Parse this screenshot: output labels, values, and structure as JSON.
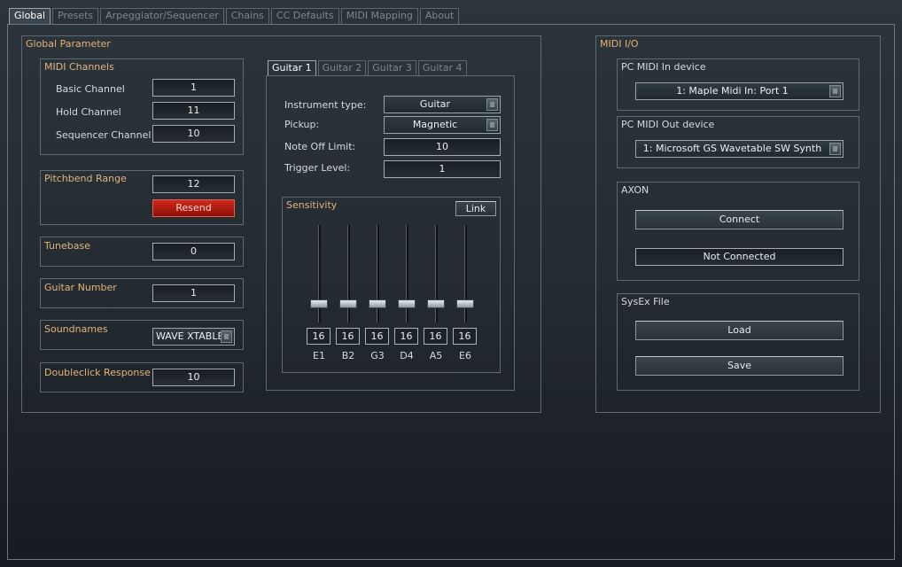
{
  "tabs": [
    "Global",
    "Presets",
    "Arpeggiator/Sequencer",
    "Chains",
    "CC Defaults",
    "MIDI Mapping",
    "About"
  ],
  "active_tab": "Global",
  "global_parameter": {
    "title": "Global Parameter",
    "midi_channels": {
      "title": "MIDI Channels",
      "basic_label": "Basic Channel",
      "basic_value": "1",
      "hold_label": "Hold Channel",
      "hold_value": "11",
      "sequencer_label": "Sequencer Channel",
      "sequencer_value": "10"
    },
    "pitchbend": {
      "title": "Pitchbend Range",
      "value": "12",
      "resend": "Resend"
    },
    "tunebase": {
      "title": "Tunebase",
      "value": "0"
    },
    "guitar_number": {
      "title": "Guitar Number",
      "value": "1"
    },
    "soundnames": {
      "title": "Soundnames",
      "value": "WAVE XTABLE"
    },
    "doubleclick": {
      "title": "Doubleclick Response",
      "value": "10"
    }
  },
  "guitar_tabs": [
    "Guitar 1",
    "Guitar 2",
    "Guitar 3",
    "Guitar 4"
  ],
  "guitar": {
    "instrument_type_label": "Instrument type:",
    "instrument_type": "Guitar",
    "pickup_label": "Pickup:",
    "pickup": "Magnetic",
    "note_off_label": "Note Off Limit:",
    "note_off": "10",
    "trigger_label": "Trigger Level:",
    "trigger": "1",
    "sensitivity": {
      "title": "Sensitivity",
      "link": "Link",
      "strings": [
        {
          "name": "E1",
          "value": "16",
          "level": 16
        },
        {
          "name": "B2",
          "value": "16",
          "level": 16
        },
        {
          "name": "G3",
          "value": "16",
          "level": 16
        },
        {
          "name": "D4",
          "value": "16",
          "level": 16
        },
        {
          "name": "A5",
          "value": "16",
          "level": 16
        },
        {
          "name": "E6",
          "value": "16",
          "level": 16
        }
      ]
    }
  },
  "midi_io": {
    "title": "MIDI I/O",
    "in_title": "PC MIDI In device",
    "in_device": "1: Maple Midi In: Port 1",
    "out_title": "PC MIDI Out device",
    "out_device": "1: Microsoft GS Wavetable SW Synth"
  },
  "axon": {
    "title": "AXON",
    "connect": "Connect",
    "status": "Not Connected"
  },
  "sysex": {
    "title": "SysEx File",
    "load": "Load",
    "save": "Save"
  },
  "colors": {
    "accent_label": "#e4b47a",
    "resend_red": "#c0180e",
    "background": "#252d33"
  }
}
